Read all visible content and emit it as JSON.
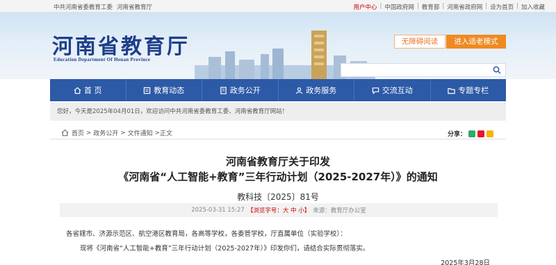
{
  "topbar": {
    "left_links": [
      "中共河南省委教育工委",
      "河南省教育厅"
    ],
    "user_center": "用户中心",
    "right_links": [
      "中国政府网",
      "教育部",
      "河南省政府网",
      "设为首页",
      "加入收藏"
    ]
  },
  "banner": {
    "title_cn": "河南省教育厅",
    "title_en": "Education Department Of Henan Province",
    "accessible_btn": "无障碍阅读",
    "elder_btn": "进入适老模式",
    "search_placeholder": ""
  },
  "nav": {
    "items": [
      {
        "label": "首 页",
        "icon": "home-icon"
      },
      {
        "label": "教育动态",
        "icon": "news-icon"
      },
      {
        "label": "政务公开",
        "icon": "document-icon"
      },
      {
        "label": "政务服务",
        "icon": "service-icon"
      },
      {
        "label": "交流互动",
        "icon": "chat-icon"
      },
      {
        "label": "专题专栏",
        "icon": "folder-icon"
      }
    ]
  },
  "notice": "您好，今天是2025年04月01日，欢迎访问中共河南省委教育工委、河南省教育厅网站！",
  "breadcrumb": {
    "items": [
      "首页",
      "政务公开",
      "文件通知",
      "正文"
    ],
    "share_label": "分享："
  },
  "article": {
    "title_line1": "河南省教育厅关于印发",
    "title_line2": "《河南省“人工智能+教育”三年行动计划（2025-2027年）》的通知",
    "doc_number": "教科技〔2025〕81号",
    "datetime": "2025-03-31 15:27",
    "font_size_label": "【浏览字号：大 中 小】",
    "source": "来源：教育厅办公室",
    "recipients": "各省辖市、济源示范区、航空港区教育局，各高等学校，各委管学校，厅直属单位（实验学校）：",
    "body": "现将《河南省“人工智能+教育”三年行动计划（2025-2027年）》印发你们，请结合实际贯彻落实。",
    "date": "2025年3月28日"
  },
  "colors": {
    "nav_bg": "#2d5aa6",
    "title_blue": "#1e3f8a",
    "accent_orange": "#ef8a22",
    "red": "#cc0000"
  }
}
